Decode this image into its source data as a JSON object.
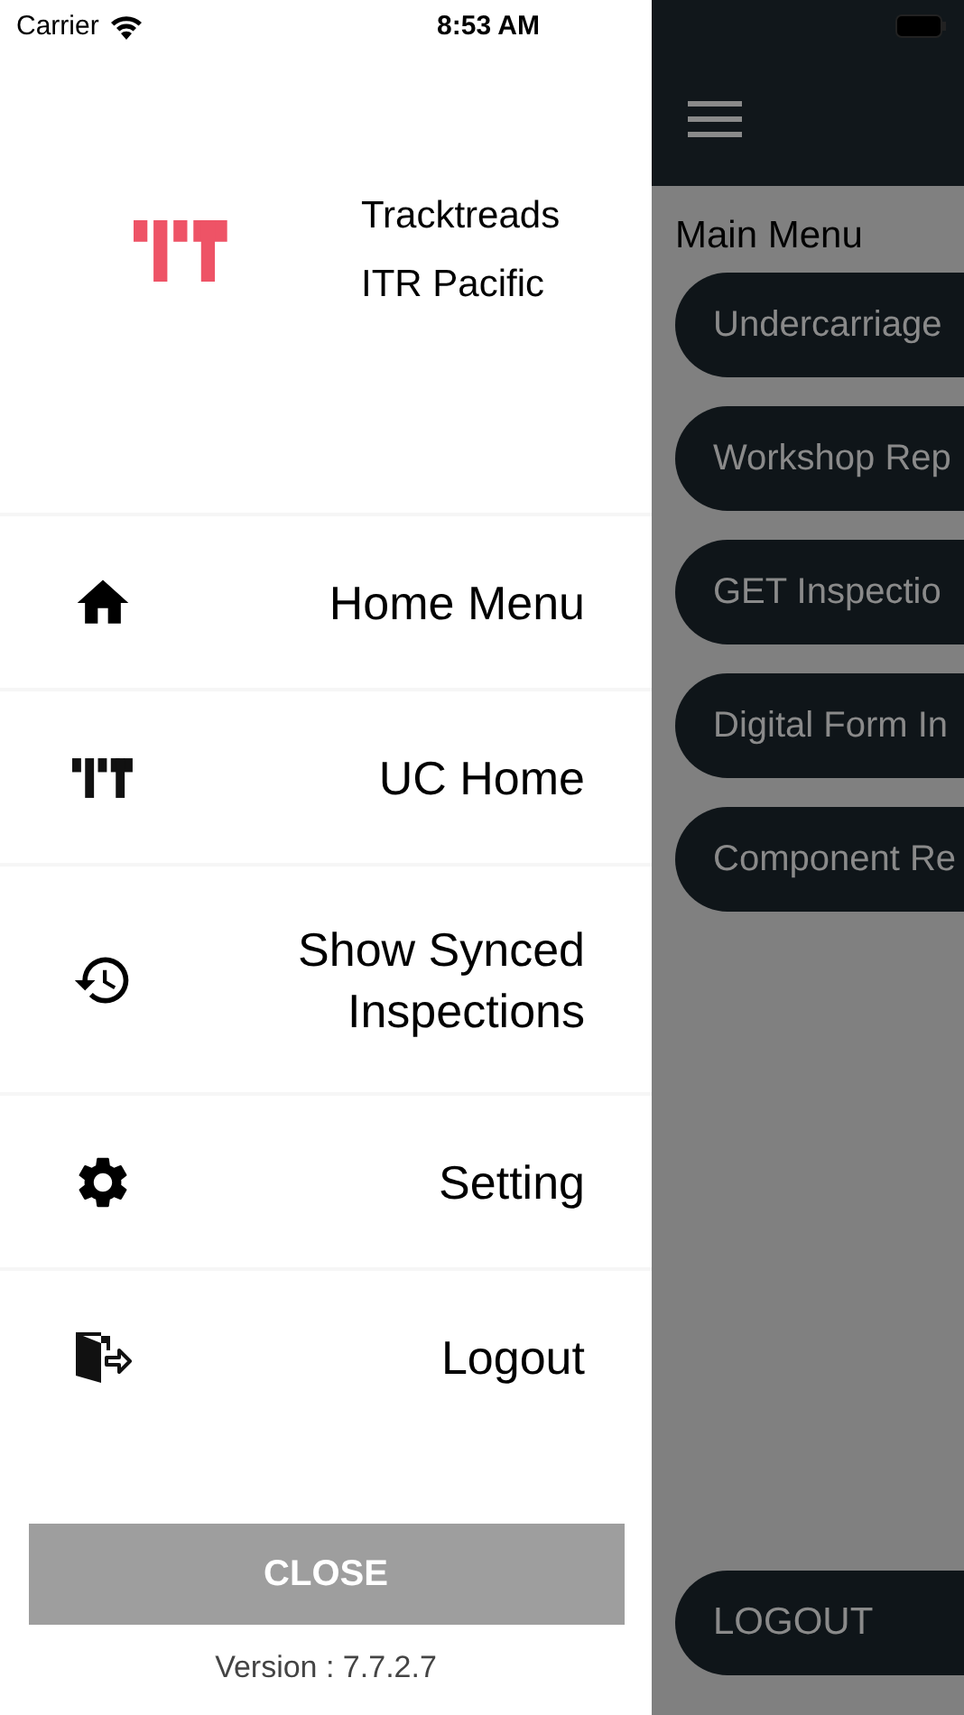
{
  "status_bar": {
    "carrier": "Carrier",
    "time": "8:53 AM"
  },
  "drawer": {
    "company": "Tracktreads",
    "branch": "ITR Pacific",
    "items": [
      {
        "label": "Home Menu",
        "kind": "home"
      },
      {
        "label": "UC Home",
        "kind": "tracks"
      },
      {
        "label": "Show Synced Inspections",
        "kind": "history"
      },
      {
        "label": "Setting",
        "kind": "gear"
      },
      {
        "label": "Logout",
        "kind": "exit"
      }
    ],
    "close_button": "CLOSE",
    "version": "Version : 7.7.2.7"
  },
  "main": {
    "heading": "Main Menu",
    "buttons": [
      "Undercarriage",
      "Workshop Rep",
      "GET Inspectio",
      "Digital Form In",
      "Component Re"
    ],
    "logout_button": "LOGOUT"
  }
}
